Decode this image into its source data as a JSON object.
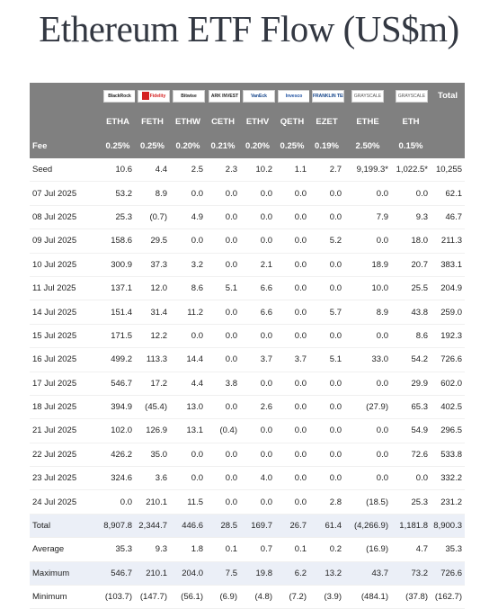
{
  "title": "Ethereum ETF Flow (US$m)",
  "issuers": [
    {
      "name": "BlackRock",
      "icon": "blackrock-logo"
    },
    {
      "name": "Fidelity",
      "icon": "fidelity-logo"
    },
    {
      "name": "Bitwise",
      "icon": "bitwise-logo"
    },
    {
      "name": "ARK INVEST",
      "icon": "ark-logo"
    },
    {
      "name": "VanEck",
      "icon": "vaneck-logo"
    },
    {
      "name": "Invesco",
      "icon": "invesco-logo"
    },
    {
      "name": "FRANKLIN TEMPLETON",
      "icon": "franklin-logo"
    },
    {
      "name": "GRAYSCALE",
      "icon": "grayscale-logo"
    },
    {
      "name": "GRAYSCALE",
      "icon": "grayscale-logo"
    }
  ],
  "total_header": "Total",
  "tickers": [
    "ETHA",
    "FETH",
    "ETHW",
    "CETH",
    "ETHV",
    "QETH",
    "EZET",
    "ETHE",
    "ETH"
  ],
  "fee": {
    "label": "Fee",
    "values": [
      "0.25%",
      "0.25%",
      "0.20%",
      "0.21%",
      "0.20%",
      "0.25%",
      "0.19%",
      "2.50%",
      "0.15%"
    ]
  },
  "rows": [
    {
      "label": "Seed",
      "values": [
        "10.6",
        "4.4",
        "2.5",
        "2.3",
        "10.2",
        "1.1",
        "2.7",
        "9,199.3*",
        "1,022.5*",
        "10,255"
      ]
    },
    {
      "label": "07 Jul 2025",
      "values": [
        "53.2",
        "8.9",
        "0.0",
        "0.0",
        "0.0",
        "0.0",
        "0.0",
        "0.0",
        "0.0",
        "62.1"
      ]
    },
    {
      "label": "08 Jul 2025",
      "values": [
        "25.3",
        "(0.7)",
        "4.9",
        "0.0",
        "0.0",
        "0.0",
        "0.0",
        "7.9",
        "9.3",
        "46.7"
      ]
    },
    {
      "label": "09 Jul 2025",
      "values": [
        "158.6",
        "29.5",
        "0.0",
        "0.0",
        "0.0",
        "0.0",
        "5.2",
        "0.0",
        "18.0",
        "211.3"
      ]
    },
    {
      "label": "10 Jul 2025",
      "values": [
        "300.9",
        "37.3",
        "3.2",
        "0.0",
        "2.1",
        "0.0",
        "0.0",
        "18.9",
        "20.7",
        "383.1"
      ]
    },
    {
      "label": "11 Jul 2025",
      "values": [
        "137.1",
        "12.0",
        "8.6",
        "5.1",
        "6.6",
        "0.0",
        "0.0",
        "10.0",
        "25.5",
        "204.9"
      ]
    },
    {
      "label": "14 Jul 2025",
      "values": [
        "151.4",
        "31.4",
        "11.2",
        "0.0",
        "6.6",
        "0.0",
        "5.7",
        "8.9",
        "43.8",
        "259.0"
      ]
    },
    {
      "label": "15 Jul 2025",
      "values": [
        "171.5",
        "12.2",
        "0.0",
        "0.0",
        "0.0",
        "0.0",
        "0.0",
        "0.0",
        "8.6",
        "192.3"
      ]
    },
    {
      "label": "16 Jul 2025",
      "values": [
        "499.2",
        "113.3",
        "14.4",
        "0.0",
        "3.7",
        "3.7",
        "5.1",
        "33.0",
        "54.2",
        "726.6"
      ]
    },
    {
      "label": "17 Jul 2025",
      "values": [
        "546.7",
        "17.2",
        "4.4",
        "3.8",
        "0.0",
        "0.0",
        "0.0",
        "0.0",
        "29.9",
        "602.0"
      ]
    },
    {
      "label": "18 Jul 2025",
      "values": [
        "394.9",
        "(45.4)",
        "13.0",
        "0.0",
        "2.6",
        "0.0",
        "0.0",
        "(27.9)",
        "65.3",
        "402.5"
      ]
    },
    {
      "label": "21 Jul 2025",
      "values": [
        "102.0",
        "126.9",
        "13.1",
        "(0.4)",
        "0.0",
        "0.0",
        "0.0",
        "0.0",
        "54.9",
        "296.5"
      ]
    },
    {
      "label": "22 Jul 2025",
      "values": [
        "426.2",
        "35.0",
        "0.0",
        "0.0",
        "0.0",
        "0.0",
        "0.0",
        "0.0",
        "72.6",
        "533.8"
      ]
    },
    {
      "label": "23 Jul 2025",
      "values": [
        "324.6",
        "3.6",
        "0.0",
        "0.0",
        "4.0",
        "0.0",
        "0.0",
        "0.0",
        "0.0",
        "332.2"
      ]
    },
    {
      "label": "24 Jul 2025",
      "values": [
        "0.0",
        "210.1",
        "11.5",
        "0.0",
        "0.0",
        "0.0",
        "2.8",
        "(18.5)",
        "25.3",
        "231.2"
      ],
      "highlight": true
    }
  ],
  "stats": [
    {
      "label": "Total",
      "values": [
        "8,907.8",
        "2,344.7",
        "446.6",
        "28.5",
        "169.7",
        "26.7",
        "61.4",
        "(4,266.9)",
        "1,181.8",
        "8,900.3"
      ]
    },
    {
      "label": "Average",
      "values": [
        "35.3",
        "9.3",
        "1.8",
        "0.1",
        "0.7",
        "0.1",
        "0.2",
        "(16.9)",
        "4.7",
        "35.3"
      ]
    },
    {
      "label": "Maximum",
      "values": [
        "546.7",
        "210.1",
        "204.0",
        "7.5",
        "19.8",
        "6.2",
        "13.2",
        "43.7",
        "73.2",
        "726.6"
      ]
    },
    {
      "label": "Minimum",
      "values": [
        "(103.7)",
        "(147.7)",
        "(56.1)",
        "(6.9)",
        "(4.8)",
        "(7.2)",
        "(3.9)",
        "(484.1)",
        "(37.8)",
        "(162.7)"
      ]
    }
  ],
  "colors": {
    "header_bg": "#808080",
    "row_shade": "#ebeff7",
    "highlight": "#a2f78c",
    "negative": "#d40000",
    "title": "#333842"
  }
}
